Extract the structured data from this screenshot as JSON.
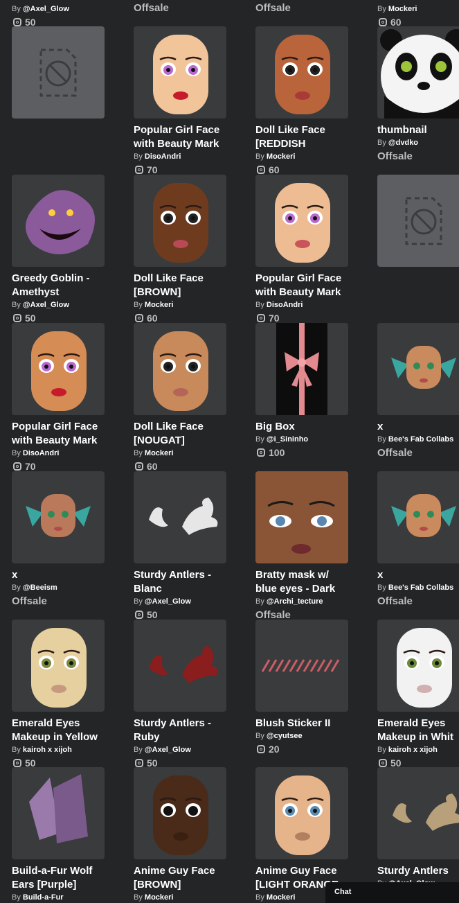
{
  "top_row": {
    "col1_creator_prefix": "By",
    "col1_creator": "@Axel_Glow",
    "col1_price": "50",
    "col2_status": "Offsale",
    "col3_status": "Offsale",
    "col4_creator_prefix": "By",
    "col4_creator": "Mockeri",
    "col4_price": "60"
  },
  "items": [
    {
      "thumb": "placeholder",
      "name": [
        "",
        ""
      ],
      "creator": "",
      "price": "",
      "offsale": ""
    },
    {
      "thumb": "face-popular-light",
      "name": [
        "Popular Girl Face",
        "with Beauty Mark"
      ],
      "creator": "DisoAndri",
      "price": "70",
      "offsale": ""
    },
    {
      "thumb": "face-doll-reddish",
      "name": [
        "Doll Like Face",
        "[REDDISH"
      ],
      "creator": "Mockeri",
      "price": "60",
      "offsale": ""
    },
    {
      "thumb": "panda",
      "name": [
        "thumbnail",
        ""
      ],
      "creator": "@dvdko",
      "price": "",
      "offsale": "Offsale"
    },
    {
      "thumb": "goblin",
      "name": [
        "Greedy Goblin -",
        "Amethyst"
      ],
      "creator": "@Axel_Glow",
      "price": "50",
      "offsale": ""
    },
    {
      "thumb": "face-doll-brown",
      "name": [
        "Doll Like Face",
        "[BROWN]"
      ],
      "creator": "Mockeri",
      "price": "60",
      "offsale": ""
    },
    {
      "thumb": "face-popular-light2",
      "name": [
        "Popular Girl Face",
        "with Beauty Mark"
      ],
      "creator": "DisoAndri",
      "price": "70",
      "offsale": ""
    },
    {
      "thumb": "placeholder",
      "name": [
        "",
        ""
      ],
      "creator": "",
      "price": "",
      "offsale": ""
    },
    {
      "thumb": "face-popular-tan",
      "name": [
        "Popular Girl Face",
        "with Beauty Mark"
      ],
      "creator": "DisoAndri",
      "price": "70",
      "offsale": ""
    },
    {
      "thumb": "face-doll-nougat",
      "name": [
        "Doll Like Face",
        "[NOUGAT]"
      ],
      "creator": "Mockeri",
      "price": "60",
      "offsale": ""
    },
    {
      "thumb": "bigbox",
      "name": [
        "Big Box",
        ""
      ],
      "creator": "@i_Sininho",
      "price": "100",
      "offsale": ""
    },
    {
      "thumb": "face-fairy",
      "name": [
        "x",
        ""
      ],
      "creator": "Bee's Fab Collabs",
      "price": "",
      "offsale": "Offsale"
    },
    {
      "thumb": "face-fairy2",
      "name": [
        "x",
        ""
      ],
      "creator": "@Beeism",
      "price": "",
      "offsale": "Offsale"
    },
    {
      "thumb": "antlers-white",
      "name": [
        "Sturdy Antlers -",
        "Blanc"
      ],
      "creator": "@Axel_Glow",
      "price": "50",
      "offsale": ""
    },
    {
      "thumb": "bratty",
      "name": [
        "Bratty mask w/",
        "blue eyes - Dark"
      ],
      "creator": "@Archi_tecture",
      "price": "",
      "offsale": "Offsale"
    },
    {
      "thumb": "face-fairy3",
      "name": [
        "x",
        ""
      ],
      "creator": "Bee's Fab Collabs",
      "price": "",
      "offsale": "Offsale"
    },
    {
      "thumb": "emerald-yellow",
      "name": [
        "Emerald Eyes",
        "Makeup in Yellow"
      ],
      "creator": "kairoh x xijoh",
      "price": "50",
      "offsale": ""
    },
    {
      "thumb": "antlers-red",
      "name": [
        "Sturdy Antlers -",
        "Ruby"
      ],
      "creator": "@Axel_Glow",
      "price": "50",
      "offsale": ""
    },
    {
      "thumb": "blush",
      "name": [
        "Blush Sticker II",
        ""
      ],
      "creator": "@cyutsee",
      "price": "20",
      "offsale": ""
    },
    {
      "thumb": "emerald-white",
      "name": [
        "Emerald Eyes",
        "Makeup in Whit"
      ],
      "creator": "kairoh x xijoh",
      "price": "50",
      "offsale": ""
    },
    {
      "thumb": "wolf-ears",
      "name": [
        "Build-a-Fur Wolf",
        "Ears [Purple]"
      ],
      "creator": "Build-a-Fur",
      "price": "",
      "offsale": ""
    },
    {
      "thumb": "anime-brown",
      "name": [
        "Anime Guy Face",
        "[BROWN]"
      ],
      "creator": "Mockeri",
      "price": "",
      "offsale": ""
    },
    {
      "thumb": "anime-orange",
      "name": [
        "Anime Guy Face",
        "[LIGHT ORANGE"
      ],
      "creator": "Mockeri",
      "price": "",
      "offsale": ""
    },
    {
      "thumb": "antlers-tan",
      "name": [
        "Sturdy Antlers",
        ""
      ],
      "creator": "@Axel_Glow",
      "price": "",
      "offsale": ""
    }
  ],
  "by_label": "By",
  "chat": {
    "label": "Chat"
  },
  "colors": {
    "background": "#232527",
    "tile": "#393b3d",
    "placeholder_tile": "#5c5e61",
    "muted_text": "#bdbebe"
  }
}
